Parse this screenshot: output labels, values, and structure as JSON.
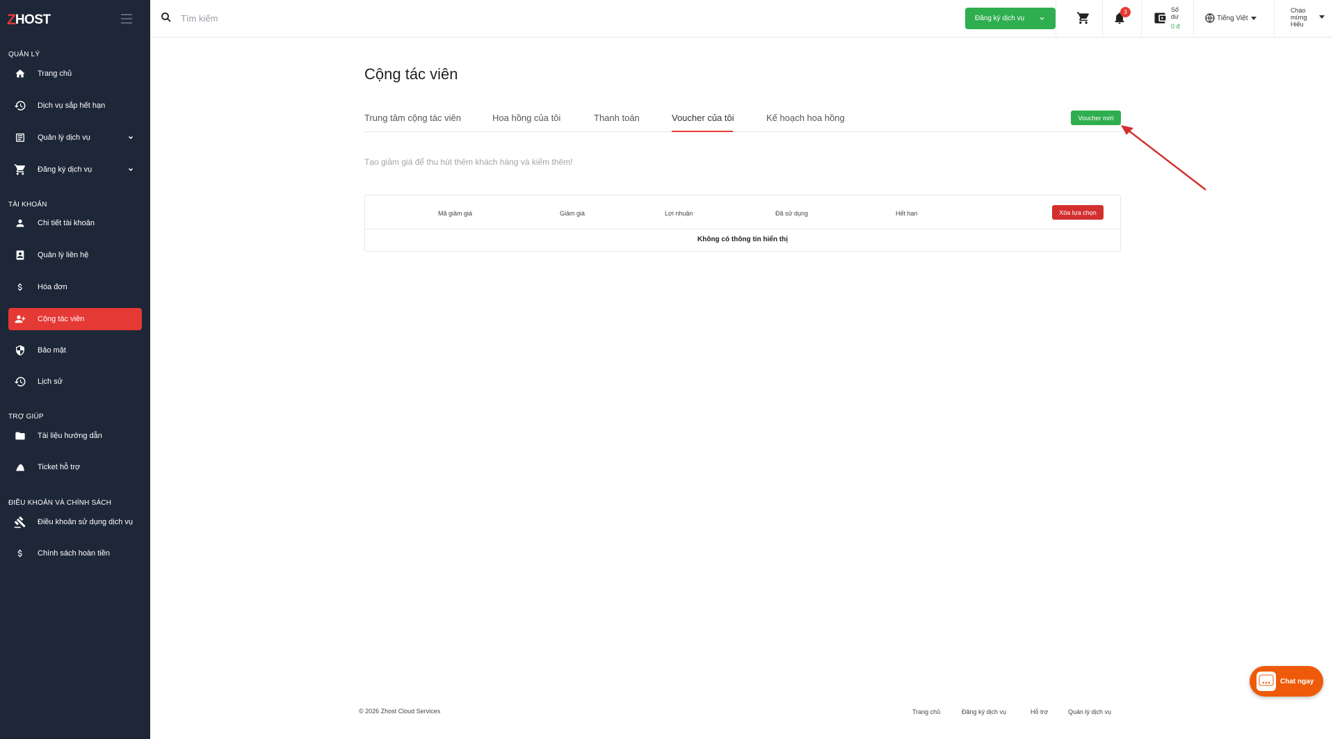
{
  "brand": {
    "logo_z": "Z",
    "logo_host": "HOST"
  },
  "sidebar": {
    "sections": {
      "manage": "QUẢN LÝ",
      "account": "TÀI KHOẢN",
      "help": "TRỢ GIÚP",
      "terms": "ĐIỀU KHOẢN VÀ CHÍNH SÁCH"
    },
    "items": {
      "home": "Trang chủ",
      "expiring": "Dịch vụ sắp hết hạn",
      "manage_services": "Quản lý dịch vụ",
      "register_services": "Đăng ký dịch vụ",
      "account_details": "Chi tiết tài khoản",
      "contacts": "Quản lý liên hệ",
      "invoices": "Hóa đơn",
      "affiliate": "Cộng tác viên",
      "security": "Bảo mật",
      "history": "Lịch sử",
      "docs": "Tài liệu hướng dẫn",
      "tickets": "Ticket hỗ trợ",
      "terms_of_use": "Điều khoản sử dụng dịch vụ",
      "refund_policy": "Chính sách hoàn tiền"
    }
  },
  "header": {
    "search_placeholder": "Tìm kiếm",
    "register_button": "Đăng ký dịch vụ",
    "notification_count": "3",
    "balance_label": "Số dư",
    "balance_value": "0 đ",
    "language": "Tiếng Việt",
    "greeting": "Chào mừng Hiếu"
  },
  "main": {
    "title": "Cộng tác viên",
    "tabs": {
      "center": "Trung tâm cộng tác viên",
      "commission": "Hoa hồng của tôi",
      "payment": "Thanh toán",
      "vouchers": "Voucher của tôi",
      "plans": "Kế hoạch hoa hồng"
    },
    "new_voucher_button": "Voucher mới",
    "subtitle": "Tạo giảm giá để thu hút thêm khách hàng và kiếm thêm!",
    "table": {
      "columns": {
        "code": "Mã giảm giá",
        "discount": "Giảm giá",
        "profit": "Lợi nhuận",
        "used": "Đã sử dụng",
        "expiry": "Hết hạn"
      },
      "clear_button": "Xóa lựa chọn",
      "empty_text": "Không có thông tin hiển thị"
    }
  },
  "footer": {
    "copyright": "© 2026 Zhost Cloud Services",
    "links": {
      "home": "Trang chủ",
      "register": "Đăng ký dịch vụ",
      "support": "Hỗ trợ",
      "manage": "Quản lý dịch vụ"
    }
  },
  "chat": {
    "label": "Chat ngay"
  },
  "colors": {
    "sidebar_bg": "#1e2738",
    "accent_red": "#e53935",
    "accent_green": "#2fae4f",
    "chat_orange": "#ee5a0a"
  }
}
